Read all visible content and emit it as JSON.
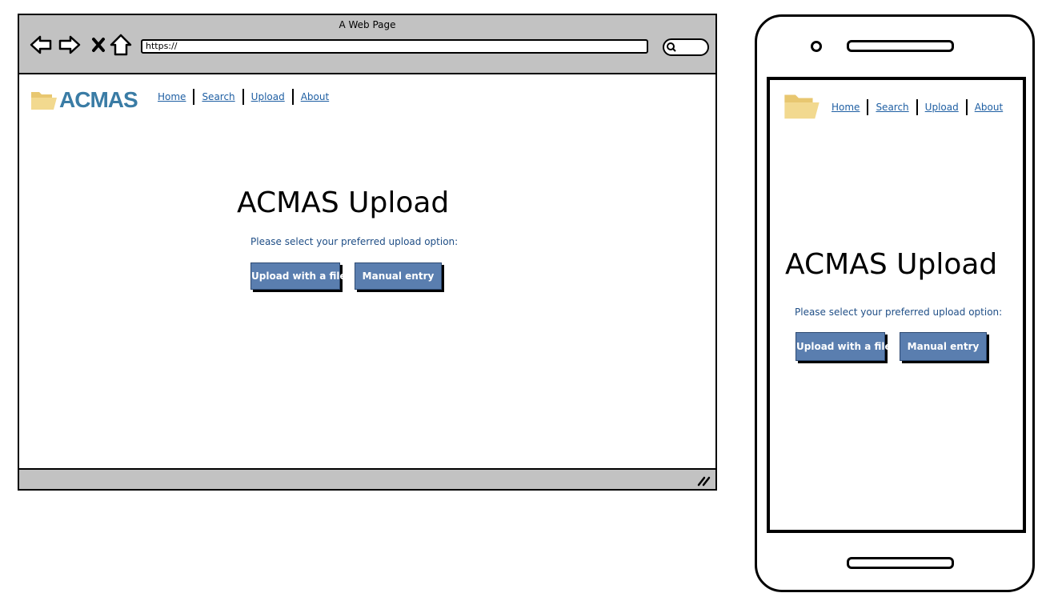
{
  "browser": {
    "window_title": "A Web Page",
    "address": "https://",
    "icons": [
      "back-arrow-icon",
      "forward-arrow-icon",
      "close-x-icon",
      "home-icon",
      "search-icon",
      "resize-grip-icon"
    ]
  },
  "site": {
    "logo_text": "ACMAS",
    "nav": {
      "home": "Home",
      "search": "Search",
      "upload": "Upload",
      "about": "About"
    },
    "title": "ACMAS Upload",
    "subtitle": "Please select your preferred upload option:",
    "buttons": {
      "upload_file": "Upload with a file",
      "manual_entry": "Manual entry"
    }
  },
  "colors": {
    "logo": "#3a7ca5",
    "folder": "#f2d98f",
    "link": "#1f5fa3",
    "button": "#5a7eaf",
    "chrome": "#c2c2c2"
  }
}
